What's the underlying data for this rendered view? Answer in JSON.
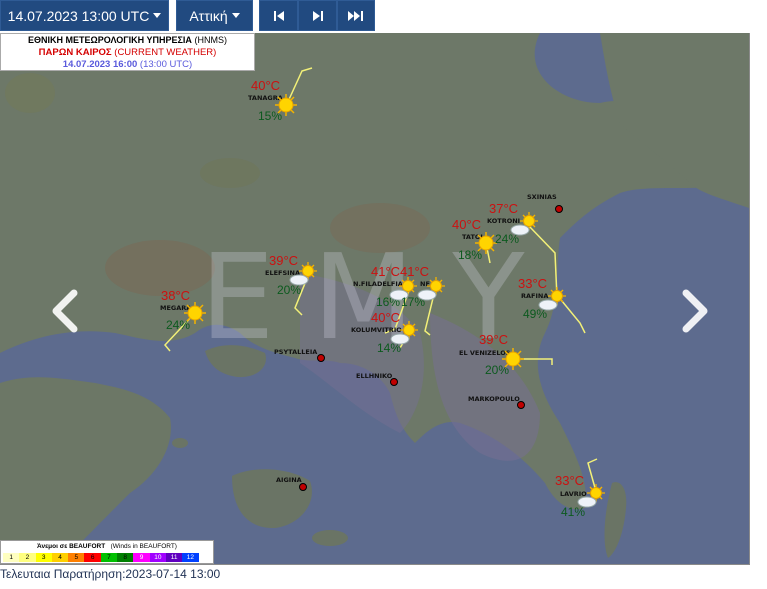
{
  "toolbar": {
    "datetime": "14.07.2023 13:00 UTC",
    "region": "Αττική"
  },
  "header": {
    "agency": "ΕΘΝΙΚΗ ΜΕΤΕΩΡΟΛΟΓΙΚΗ ΥΠΗΡΕΣΙΑ",
    "agency_en": "(HNMS)",
    "title": "ΠΑΡΩΝ ΚΑΙΡΟΣ",
    "title_en": "(CURRENT WEATHER)",
    "local_time": "14.07.2023 16:00",
    "utc_time": "(13:00 UTC)"
  },
  "watermark": "EMY",
  "icons": [
    "first-frame-icon",
    "next-frame-icon",
    "last-frame-icon",
    "prev-arrow-icon",
    "next-arrow-icon",
    "sun-icon",
    "sun-cloud-icon",
    "wind-barb"
  ],
  "stations": [
    {
      "name": "TANAGRA",
      "temp": "40°C",
      "hum": "15%",
      "icon": "sun"
    },
    {
      "name": "ELEFSINA",
      "temp": "39°C",
      "hum": "20%",
      "icon": "sun-cloud"
    },
    {
      "name": "MEGARA",
      "temp": "38°C",
      "hum": "24%",
      "icon": "sun"
    },
    {
      "name": "N.FILADELFIA",
      "temp": "41°C",
      "hum": "16%",
      "icon": "sun-cloud"
    },
    {
      "name": "NEA",
      "temp": "41°C",
      "hum": "17%",
      "icon": "sun-cloud"
    },
    {
      "name": "KOLUMVITRIO",
      "temp": "40°C",
      "hum": "14%",
      "icon": "sun-cloud"
    },
    {
      "name": "TATOI",
      "temp": "40°C",
      "hum": "18%",
      "icon": "sun"
    },
    {
      "name": "KOTRONI",
      "temp": "37°C",
      "hum": "24%",
      "icon": "sun-cloud"
    },
    {
      "name": "RAFINA",
      "temp": "33°C",
      "hum": "49%",
      "icon": "sun-cloud"
    },
    {
      "name": "EL VENIZELOS",
      "temp": "39°C",
      "hum": "20%",
      "icon": "sun"
    },
    {
      "name": "LAVRIO",
      "temp": "33°C",
      "hum": "41%",
      "icon": "sun-cloud"
    }
  ],
  "other_stations": [
    "SXINIAS",
    "PSYTALLEIA",
    "ELLHNIKO",
    "MARKOPOULO",
    "AIGINA"
  ],
  "legend": {
    "title": "Άνεμοι σε BEAUFORT",
    "subtitle": "(Winds in BEAUFORT)",
    "scale": [
      "1",
      "2",
      "3",
      "4",
      "5",
      "6",
      "7",
      "8",
      "9",
      "10",
      "11",
      "12"
    ],
    "colors": [
      "#ffffc0",
      "#ffff80",
      "#ffff00",
      "#ffd000",
      "#ff8000",
      "#ff0000",
      "#00c000",
      "#008000",
      "#ff00ff",
      "#a000ff",
      "#6000c0",
      "#0040ff"
    ]
  },
  "footer": {
    "label": "Τελευταια Παρατήρηση:",
    "value": "2023-07-14 13:00"
  }
}
